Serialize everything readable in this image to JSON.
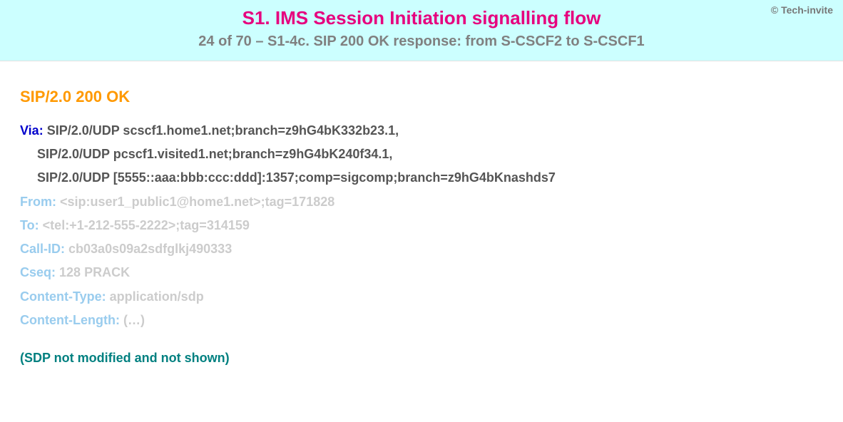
{
  "copyright": "© Tech-invite",
  "title": "S1. IMS Session Initiation signalling flow",
  "subtitle": "24 of 70 – S1-4c. SIP 200 OK response: from S-CSCF2 to S-CSCF1",
  "status_line": "SIP/2.0 200 OK",
  "headers": {
    "via": {
      "name": "Via",
      "values": [
        "SIP/2.0/UDP scscf1.home1.net;branch=z9hG4bK332b23.1,",
        "SIP/2.0/UDP pcscf1.visited1.net;branch=z9hG4bK240f34.1,",
        "SIP/2.0/UDP [5555::aaa:bbb:ccc:ddd]:1357;comp=sigcomp;branch=z9hG4bKnashds7"
      ]
    },
    "from": {
      "name": "From",
      "value": "<sip:user1_public1@home1.net>;tag=171828"
    },
    "to": {
      "name": "To",
      "value": "<tel:+1-212-555-2222>;tag=314159"
    },
    "call_id": {
      "name": "Call-ID",
      "value": "cb03a0s09a2sdfglkj490333"
    },
    "cseq": {
      "name": "Cseq",
      "value": "128 PRACK"
    },
    "content_type": {
      "name": "Content-Type",
      "value": "application/sdp"
    },
    "content_length": {
      "name": "Content-Length",
      "value": "(…)"
    }
  },
  "note": "(SDP not modified and not shown)"
}
